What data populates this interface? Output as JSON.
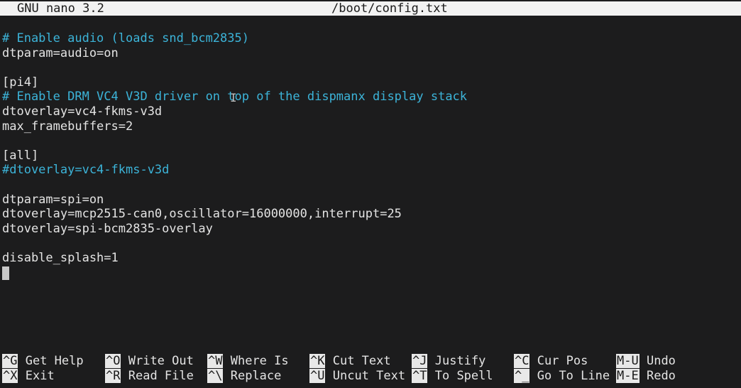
{
  "app": {
    "name": "GNU nano 3.2",
    "file": "/boot/config.txt"
  },
  "lines": [
    {
      "text": "# Enable audio (loads snd_bcm2835)",
      "kind": "comment"
    },
    {
      "text": "dtparam=audio=on",
      "kind": "normal"
    },
    {
      "text": "",
      "kind": "normal"
    },
    {
      "text": "[pi4]",
      "kind": "normal"
    },
    {
      "text": "# Enable DRM VC4 V3D driver on top of the dispmanx display stack",
      "kind": "comment"
    },
    {
      "text": "dtoverlay=vc4-fkms-v3d",
      "kind": "normal"
    },
    {
      "text": "max_framebuffers=2",
      "kind": "normal"
    },
    {
      "text": "",
      "kind": "normal"
    },
    {
      "text": "[all]",
      "kind": "normal"
    },
    {
      "text": "#dtoverlay=vc4-fkms-v3d",
      "kind": "comment"
    },
    {
      "text": "",
      "kind": "normal"
    },
    {
      "text": "dtparam=spi=on",
      "kind": "normal"
    },
    {
      "text": "dtoverlay=mcp2515-can0,oscillator=16000000,interrupt=25",
      "kind": "normal"
    },
    {
      "text": "dtoverlay=spi-bcm2835-overlay",
      "kind": "normal"
    },
    {
      "text": "",
      "kind": "normal"
    },
    {
      "text": "disable_splash=1",
      "kind": "normal"
    }
  ],
  "shortcuts": {
    "row1": [
      {
        "key": "^G",
        "label": "Get Help"
      },
      {
        "key": "^O",
        "label": "Write Out"
      },
      {
        "key": "^W",
        "label": "Where Is"
      },
      {
        "key": "^K",
        "label": "Cut Text"
      },
      {
        "key": "^J",
        "label": "Justify"
      },
      {
        "key": "^C",
        "label": "Cur Pos"
      },
      {
        "key": "M-U",
        "label": "Undo"
      }
    ],
    "row2": [
      {
        "key": "^X",
        "label": "Exit"
      },
      {
        "key": "^R",
        "label": "Read File"
      },
      {
        "key": "^\\",
        "label": "Replace"
      },
      {
        "key": "^U",
        "label": "Uncut Text"
      },
      {
        "key": "^T",
        "label": "To Spell"
      },
      {
        "key": "^_",
        "label": "Go To Line"
      },
      {
        "key": "M-E",
        "label": "Redo"
      }
    ]
  },
  "colors": {
    "background": "#1c1c1d",
    "comment": "#3cb4d9",
    "text": "#e4e4e4",
    "titlebar_bg": "#f2f2f2"
  }
}
